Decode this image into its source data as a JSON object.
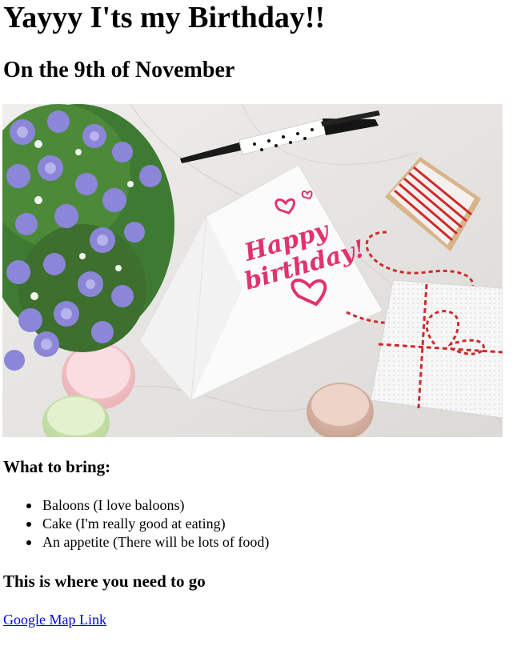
{
  "page": {
    "heading": "Yayyy I'ts my Birthday!!",
    "subheading": "On the 9th of November"
  },
  "image": {
    "alt": "Birthday card with flowers, macarons, pen and gift"
  },
  "bring": {
    "title": "What to bring:",
    "items": [
      "Baloons (I love baloons)",
      "Cake (I'm really good at eating)",
      "An appetite (There will be lots of food)"
    ]
  },
  "directions": {
    "title": "This is where you need to go",
    "link_text": "Google Map Link"
  },
  "colors": {
    "link": "#0000ee",
    "card_text": "#e0336e"
  }
}
